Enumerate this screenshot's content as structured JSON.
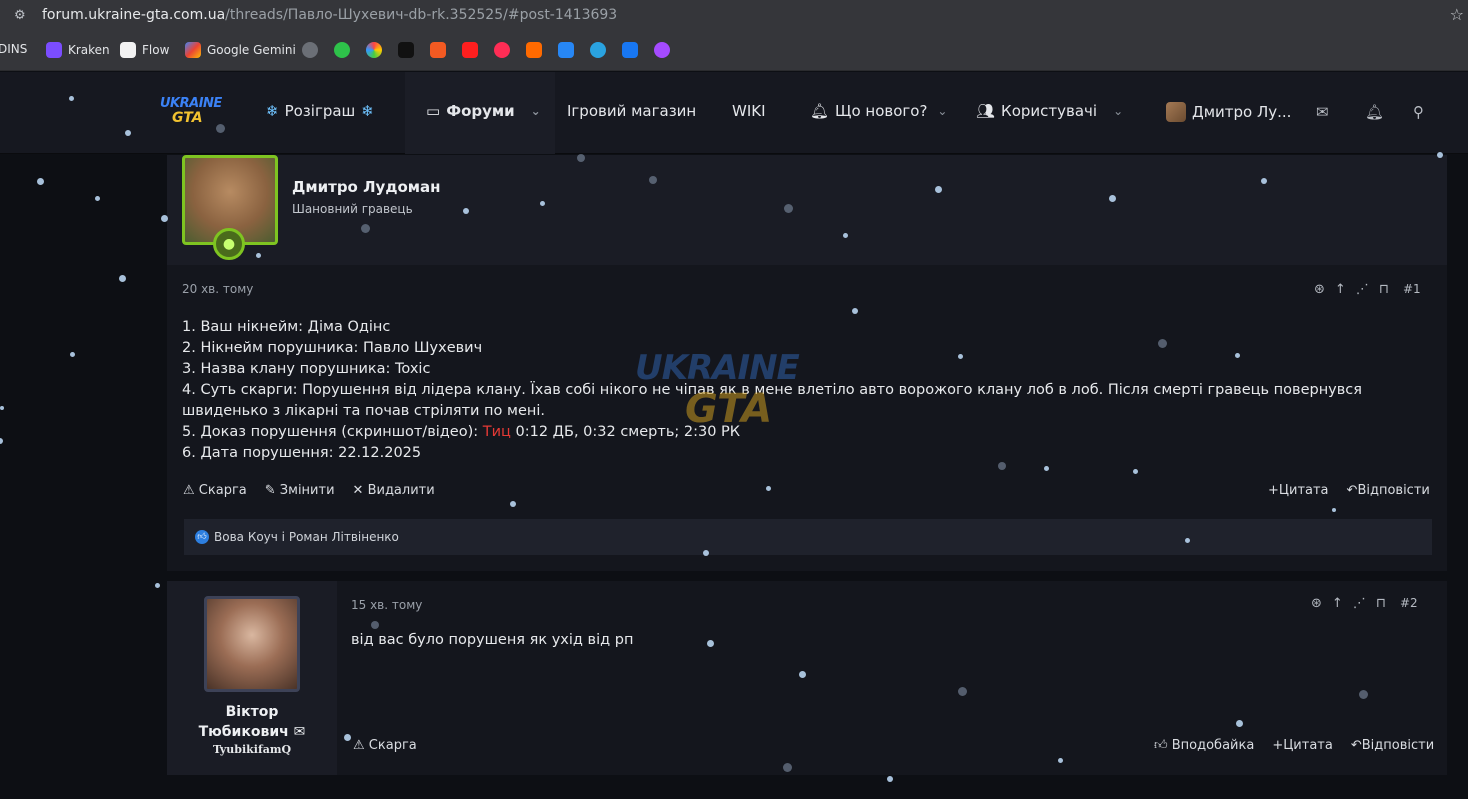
{
  "browser": {
    "url_host": "forum.ukraine-gta.com.ua",
    "url_path": "/threads/Павло-Шухевич-db-rk.352525/#post-1413693",
    "bookmarks": [
      "DINS",
      "Kraken",
      "Flow",
      "Google Gemini"
    ]
  },
  "header": {
    "logo_top": "UKRAINE",
    "logo_bottom": "GTA",
    "nav": {
      "giveaway": "Розіграш",
      "forums": "Форуми",
      "shop": "Ігровий магазин",
      "wiki": "WIKI",
      "whats_new": "Що нового?",
      "users": "Користувачі",
      "account": "Дмитро Лу..."
    }
  },
  "post1": {
    "author": "Дмитро Лудоман",
    "user_title": "Шановний гравець",
    "time": "20 хв. тому",
    "number": "#1",
    "lines": {
      "l1": "1. Ваш нікнейм: Діма Одінс",
      "l2": "2. Нікнейм порушника: Павло Шухевич",
      "l3": "3. Назва клану порушника: Toxic",
      "l4": "4. Суть скарги: Порушення від лідера клану. Їхав собі нікого не чіпав як в мене влетіло авто ворожого клану лоб в лоб. Після смерті гравець повернувся швиденько з лікарні та почав стріляти по мені.",
      "l5_prefix": "5. Доказ порушення (скриншот/відео): ",
      "l5_link": "Тиц",
      "l5_suffix": " 0:12 ДБ, 0:32 смерть; 2:30 РК",
      "l6": "6. Дата порушення: 22.12.2025"
    },
    "actions": {
      "report": "Скарга",
      "edit": "Змінити",
      "delete": "Видалити",
      "quote": "Цитата",
      "reply": "Відповісти"
    },
    "reactions": "Вова Коуч і Роман Літвіненко"
  },
  "post2": {
    "author_line1": "Віктор",
    "author_line2": "Тюбикович",
    "user_id": "TyubikifamQ",
    "time": "15 хв. тому",
    "number": "#2",
    "text": "від вас було порушеня як ухід від рп",
    "actions": {
      "report": "Скарга",
      "like": "Вподобайка",
      "quote": "Цитата",
      "reply": "Відповісти"
    }
  },
  "watermark": {
    "top": "UKRAINE",
    "bottom": "GTA"
  }
}
